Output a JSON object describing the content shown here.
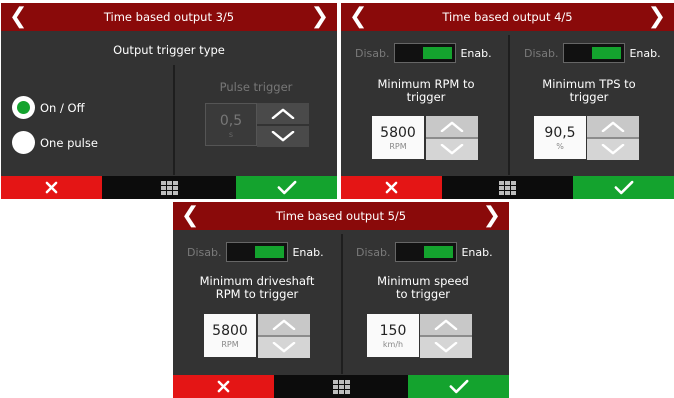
{
  "nav": {
    "prev_icon": "chevron-left-icon",
    "next_icon": "chevron-right-icon",
    "prev_glyph": "❮",
    "next_glyph": "❯"
  },
  "footer": {
    "cancel_icon": "close-icon",
    "menu_icon": "grid-menu-icon",
    "ok_icon": "check-icon"
  },
  "colors": {
    "header": "#8a0a0a",
    "cancel": "#e41515",
    "ok": "#14a32e",
    "background": "#333333"
  },
  "screen3": {
    "title": "Time based output 3/5",
    "subtitle": "Output trigger type",
    "options": [
      {
        "label": "On / Off",
        "selected": true
      },
      {
        "label": "One pulse",
        "selected": false
      }
    ],
    "pulse": {
      "label": "Pulse trigger",
      "value": "0,5",
      "unit": "s",
      "enabled": false
    }
  },
  "screen4": {
    "title": "Time based output 4/5",
    "left": {
      "disable_label": "Disab.",
      "enable_label": "Enab.",
      "enabled": true,
      "label": "Minimum RPM to trigger",
      "value": "5800",
      "unit": "RPM"
    },
    "right": {
      "disable_label": "Disab.",
      "enable_label": "Enab.",
      "enabled": true,
      "label": "Minimum TPS to trigger",
      "value": "90,5",
      "unit": "%"
    }
  },
  "screen5": {
    "title": "Time based output 5/5",
    "left": {
      "disable_label": "Disab.",
      "enable_label": "Enab.",
      "enabled": true,
      "label": "Minimum driveshaft RPM to trigger",
      "value": "5800",
      "unit": "RPM"
    },
    "right": {
      "disable_label": "Disab.",
      "enable_label": "Enab.",
      "enabled": true,
      "label": "Minimum speed to trigger",
      "value": "150",
      "unit": "km/h"
    }
  }
}
